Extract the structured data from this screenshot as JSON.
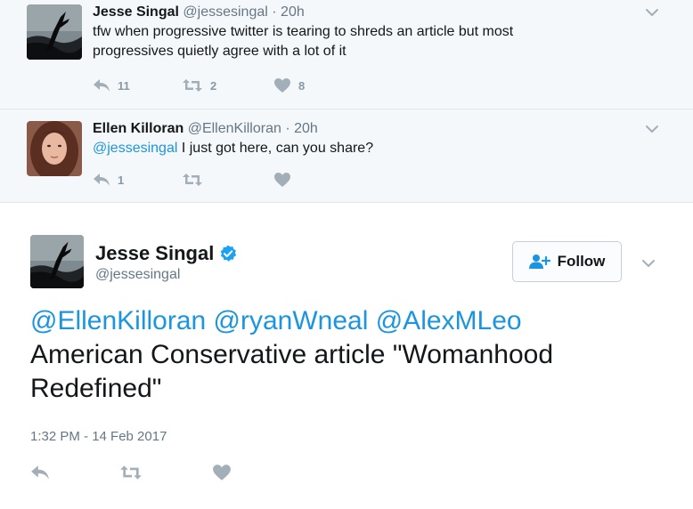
{
  "replies": [
    {
      "name": "Jesse Singal",
      "handle": "@jessesingal",
      "dot": "·",
      "time": "20h",
      "text": "tfw when progressive twitter is tearing to shreds an article but most progressives quietly agree with a lot of it",
      "reply_count": "11",
      "retweet_count": "2",
      "like_count": "8"
    },
    {
      "name": "Ellen Killoran",
      "handle": "@EllenKilloran",
      "dot": "·",
      "time": "20h",
      "mention": "@jessesingal",
      "text": " I just got here, can you share?",
      "reply_count": "1",
      "retweet_count": "",
      "like_count": ""
    }
  ],
  "main_tweet": {
    "name": "Jesse Singal",
    "handle": "@jessesingal",
    "follow_label": "Follow",
    "mentions": "@EllenKilloran @ryanWneal @AlexMLeo",
    "text": "American Conservative article \"Womanhood Redefined\"",
    "timestamp": "1:32 PM - 14 Feb 2017"
  },
  "colors": {
    "link": "#1b95e0",
    "verified": "#1da1f2",
    "icon_gray": "#a3afb8",
    "thread_bg": "#f5f8fa"
  },
  "icons": [
    "reply-icon",
    "retweet-icon",
    "like-icon",
    "chevron-down-icon",
    "verified-badge-icon",
    "follow-person-icon"
  ]
}
